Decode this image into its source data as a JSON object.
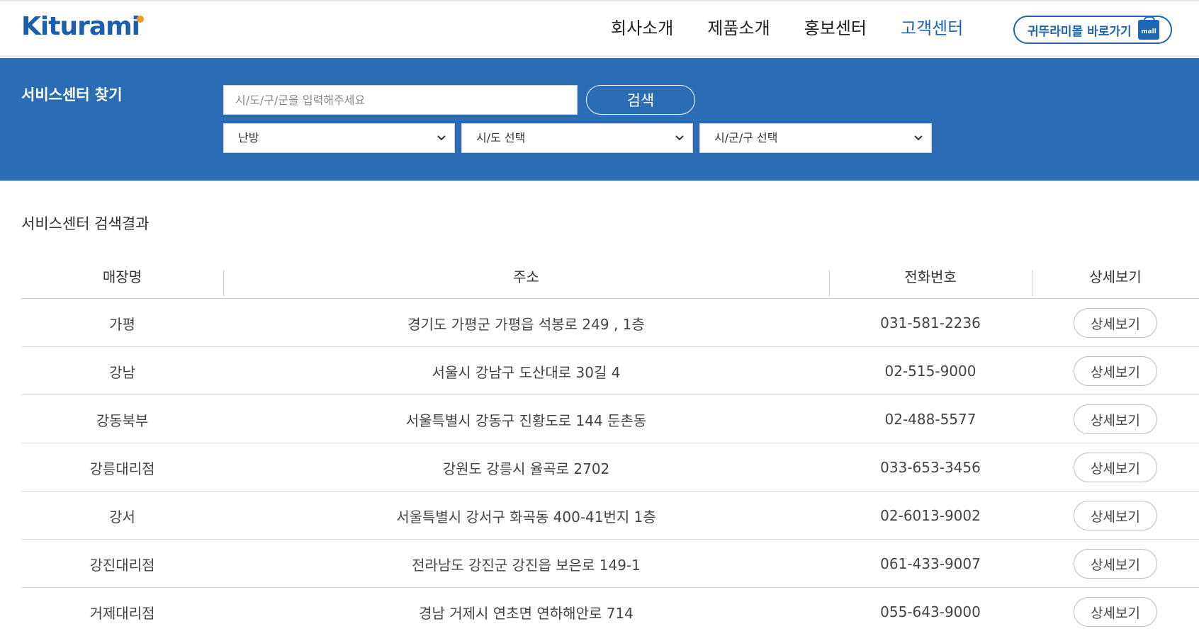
{
  "header": {
    "logo_text": "Kiturami",
    "nav": [
      {
        "label": "회사소개",
        "active": false
      },
      {
        "label": "제품소개",
        "active": false
      },
      {
        "label": "홍보센터",
        "active": false
      },
      {
        "label": "고객센터",
        "active": true
      }
    ],
    "mall_button_label": "귀뚜라미몰 바로가기",
    "mall_icon_text": "mall"
  },
  "search": {
    "title": "서비스센터 찾기",
    "placeholder": "시/도/구/군을 입력해주세요",
    "button_label": "검색",
    "selects": [
      {
        "value": "난방"
      },
      {
        "value": "시/도 선택"
      },
      {
        "value": "시/군/구 선택"
      }
    ]
  },
  "results": {
    "title": "서비스센터 검색결과",
    "columns": [
      "매장명",
      "주소",
      "전화번호",
      "상세보기"
    ],
    "detail_label": "상세보기",
    "rows": [
      {
        "name": "가평",
        "address": "경기도 가평군 가평읍 석봉로 249 , 1층",
        "phone": "031-581-2236"
      },
      {
        "name": "강남",
        "address": "서울시 강남구 도산대로 30길 4",
        "phone": "02-515-9000"
      },
      {
        "name": "강동북부",
        "address": "서울특별시 강동구 진황도로 144 둔촌동",
        "phone": "02-488-5577"
      },
      {
        "name": "강릉대리점",
        "address": "강원도 강릉시 율곡로 2702",
        "phone": "033-653-3456"
      },
      {
        "name": "강서",
        "address": "서울특별시 강서구 화곡동 400-41번지 1층",
        "phone": "02-6013-9002"
      },
      {
        "name": "강진대리점",
        "address": "전라남도 강진군 강진읍 보은로 149-1",
        "phone": "061-433-9007"
      },
      {
        "name": "거제대리점",
        "address": "경남 거제시 연초면 연하해안로 714",
        "phone": "055-643-9000"
      }
    ]
  },
  "colors": {
    "brand_blue": "#2a6db4",
    "logo_orange": "#f39a1f"
  }
}
